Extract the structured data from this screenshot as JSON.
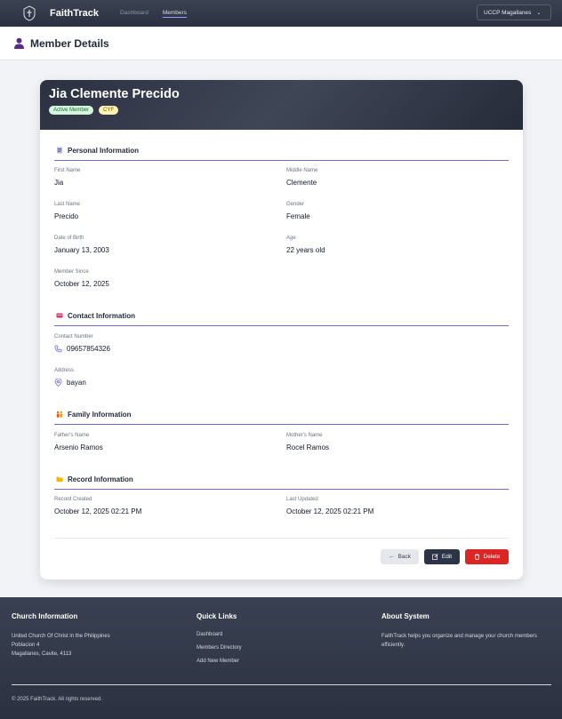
{
  "navbar": {
    "brand": "FaithTrack",
    "links": [
      "Dashboard",
      "Members"
    ],
    "church_select": "UCCP Magallanes"
  },
  "page": {
    "title": "Member Details"
  },
  "member": {
    "name": "Jia Clemente Precido",
    "badges": [
      "Active Member",
      "CYF"
    ]
  },
  "sections": {
    "personal": {
      "title": "Personal Information",
      "fields": {
        "first_name": {
          "label": "First Name",
          "value": "Jia"
        },
        "middle_name": {
          "label": "Middle Name",
          "value": "Clemente"
        },
        "last_name": {
          "label": "Last Name",
          "value": "Precido"
        },
        "gender": {
          "label": "Gender",
          "value": "Female"
        },
        "dob": {
          "label": "Date of Birth",
          "value": "January 13, 2003"
        },
        "age": {
          "label": "Age",
          "value": "22 years old"
        },
        "member_since": {
          "label": "Member Since",
          "value": "October 12, 2025"
        }
      }
    },
    "contact": {
      "title": "Contact Information",
      "fields": {
        "contact_number": {
          "label": "Contact Number",
          "value": "09657854326"
        },
        "address": {
          "label": "Address",
          "value": "bayan"
        }
      }
    },
    "family": {
      "title": "Family Information",
      "fields": {
        "father": {
          "label": "Father's Name",
          "value": "Arsenio Ramos"
        },
        "mother": {
          "label": "Mother's Name",
          "value": "Rocel Ramos"
        }
      }
    },
    "record": {
      "title": "Record Information",
      "fields": {
        "created": {
          "label": "Record Created",
          "value": "October 12, 2025 02:21 PM"
        },
        "updated": {
          "label": "Last Updated",
          "value": "October 12, 2025 02:21 PM"
        }
      }
    }
  },
  "actions": {
    "back": "Back",
    "edit": "Edit",
    "delete": "Delete"
  },
  "footer": {
    "church": {
      "title": "Church Information",
      "lines": [
        "United Church Of Christ in the Philippines",
        "Poblacion 4",
        "Magallanes, Cavite, 4113"
      ]
    },
    "quick_links": {
      "title": "Quick Links",
      "links": [
        "Dashboard",
        "Members Directory",
        "Add New Member"
      ]
    },
    "about": {
      "title": "About System",
      "text": "FaithTrack helps you organize and manage your church members efficiently."
    },
    "copyright": "© 2025 FaithTrack. All rights reserved."
  },
  "colors": {
    "accent": "#6b6ed1",
    "danger": "#dc2626",
    "dark": "#2d3447"
  }
}
